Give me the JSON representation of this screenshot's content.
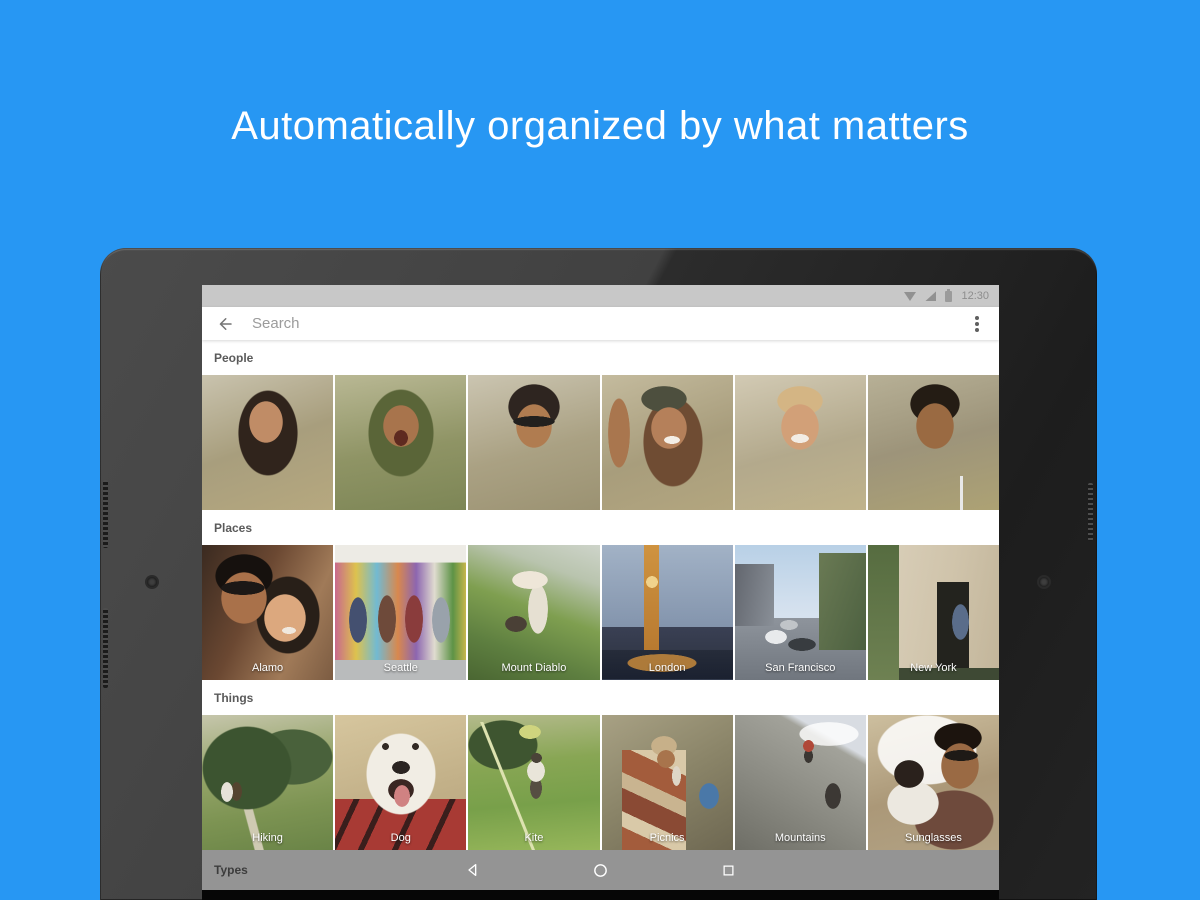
{
  "page": {
    "headline": "Automatically organized by what matters",
    "background_color": "#2797f3"
  },
  "tablet": {
    "status_bar": {
      "time": "12:30",
      "icons": [
        "wifi-icon",
        "cellular-signal-icon",
        "battery-icon"
      ]
    },
    "search_bar": {
      "back_icon": "arrow-left-icon",
      "placeholder": "Search",
      "menu_icon": "vertical-dots-icon"
    },
    "sections": [
      {
        "title": "People",
        "photos": [
          {
            "style": "background:radial-gradient(closest-side,#c08c66 0 97%,transparent) 48% 28%/34px 42px no-repeat,radial-gradient(closest-side,#30241c 0 97%,transparent) 50% 30%/60px 86px no-repeat,radial-gradient(closest-side at 50% 100%,#d9c394 0 97%,transparent) 50% 100%/110px 80px no-repeat,linear-gradient(160deg,#c9c3ae,#a89e7d 50%,#b6a87f)"
          },
          {
            "style": "background:radial-gradient(closest-side,#5e2a20 0 97%,transparent) 50% 46%/14px 16px no-repeat,radial-gradient(closest-side,#a8744c 0 97%,transparent) 50% 32%/36px 42px no-repeat,radial-gradient(closest-side,#5a6538 0 97%,transparent) 50% 30%/66px 88px no-repeat,radial-gradient(closest-side at 50% 100%,#4d5932 0 97%,transparent) 50% 100%/112px 64px no-repeat,linear-gradient(170deg,#b9b894,#8f9465 55%,#7d8656)"
          },
          {
            "style": "background:radial-gradient(closest-side,#22201e 0 97%,transparent) 50% 33%/42px 11px no-repeat,radial-gradient(closest-side,#b07c50 0 97%,transparent) 50% 32%/36px 44px no-repeat,radial-gradient(closest-side,#2e2520 0 97%,transparent) 50% 10%/52px 46px no-repeat,radial-gradient(closest-side at 50% 100%,#a84238 0 97%,transparent) 50% 100%/104px 70px no-repeat,linear-gradient(165deg,#cbc5b1,#aaa183 55%,#9b9272)"
          },
          {
            "style": "background:radial-gradient(closest-side,#f4eee6 0 97%,transparent) 54% 48%/16px 8px no-repeat,radial-gradient(closest-side,#b5805a 0 97%,transparent) 52% 34%/36px 42px no-repeat,radial-gradient(closest-side,#4d4f3e 0 97%,transparent) 46% 10%/46px 26px no-repeat,radial-gradient(closest-side,#a9764e 0 97%,transparent) 6% 35%/22px 70px no-repeat,radial-gradient(closest-side,#6f4c33 0 97%,transparent) 58% 48%/60px 90px no-repeat,radial-gradient(closest-side at 50% 100%,#aecdc9 0 97%,transparent) 50% 100%/100px 56px no-repeat,linear-gradient(160deg,#c4bb9e,#a89d7c 55%,#b3a67f)"
          },
          {
            "style": "background:radial-gradient(closest-side,#f2ece4 0 97%,transparent) 50% 47%/18px 9px no-repeat,radial-gradient(closest-side,#d2a078 0 97%,transparent) 50% 33%/38px 46px no-repeat,radial-gradient(closest-side,#d4b584 0 97%,transparent) 50% 10%/46px 30px no-repeat,radial-gradient(closest-side at 50% 100%,#3a50c0 0 97%,transparent) 50% 100%/116px 74px no-repeat,linear-gradient(165deg,#d2cab4,#b3a98c 55%,#c0b38b)"
          },
          {
            "style": "background:linear-gradient(#e8e8e8,#e8e8e8) 72% 100%/3px 34px no-repeat,radial-gradient(closest-side,#9a6a42 0 97%,transparent) 52% 32%/38px 46px no-repeat,radial-gradient(closest-side,#241c14 0 97%,transparent) 52% 9%/50px 40px no-repeat,radial-gradient(closest-side at 50% 100%,#54323a 0 97%,transparent) 50% 100%/110px 80px no-repeat,linear-gradient(165deg,#b7b096,#9d947a 50%,#ada274)"
          }
        ]
      },
      {
        "title": "Places",
        "photos": [
          {
            "label": "Alamo",
            "style": "background:radial-gradient(closest-side,#1c1816 0 97%,transparent) 22% 30%/44px 14px no-repeat,radial-gradient(closest-side,#f0e8de 0 97%,transparent) 68% 64%/14px 7px no-repeat,radial-gradient(closest-side,#a9714a 0 97%,transparent) 22% 32%/46px 52px no-repeat,radial-gradient(closest-side,#16110e 0 97%,transparent) 18% 10%/58px 44px no-repeat,radial-gradient(closest-side,#dca87e 0 97%,transparent) 70% 56%/42px 48px no-repeat,radial-gradient(closest-side,#281f18 0 97%,transparent) 80% 55%/64px 78px no-repeat,linear-gradient(115deg,#3a2a20,#6b4832 40%,#a07a58 72%,#7c5c42)"
          },
          {
            "label": "Seattle",
            "style": "background:radial-gradient(closest-side,#445070 0 97%,transparent) 12% 58%/18px 46px no-repeat,radial-gradient(closest-side,#6e4a3a 0 97%,transparent) 38% 58%/18px 48px no-repeat,radial-gradient(closest-side,#8a3c3c 0 97%,transparent) 62% 58%/18px 48px no-repeat,radial-gradient(closest-side,#99a2ab 0 97%,transparent) 86% 58%/18px 46px no-repeat,linear-gradient(#b9bbbc,#b9bbbc) 0 100%/100% 15% no-repeat,linear-gradient(#edebe5,#edebe5) 0 0/100% 13% no-repeat,linear-gradient(90deg,#c8698c,#ddc24e 16%,#72bad2 32%,#d8884e 48%,#8d66b0 62%,#e0dcd0 76%,#5d9346 90%,#c6b64c)"
          },
          {
            "label": "Mount Diablo",
            "style": "background:radial-gradient(closest-side,#eee6d8 0 97%,transparent) 46% 22%/36px 18px no-repeat,radial-gradient(closest-side,#e6e0d2 0 97%,transparent) 54% 46%/20px 50px no-repeat,radial-gradient(closest-side,#4a4036 0 97%,transparent) 34% 60%/22px 16px no-repeat,linear-gradient(200deg,#ced4ca,#b9c4ae 22%,#7f9f50 48%,#5e7f40 75%,#4a6632)"
          },
          {
            "label": "London",
            "style": "background:radial-gradient(closest-side,#f0d28c 0 97%,transparent) 37% 25%/12px 12px no-repeat,linear-gradient(#cf9340,#b87a30) 37% 0/15px 78% no-repeat,radial-gradient(closest-side,rgba(220,150,60,.75) 0 97%,transparent) 42% 93%/70px 18px no-repeat,linear-gradient(#262c3a,#1b2130) 0 100%/100% 22% no-repeat,linear-gradient(#3a4054,#323848) 0 76%/100% 20% no-repeat,linear-gradient(#a2b2c6,#8596ae 58%,#6a788f)"
          },
          {
            "label": "San Francisco",
            "style": "background:radial-gradient(closest-side,#e8eaec 0 97%,transparent) 28% 70%/22px 14px no-repeat,radial-gradient(closest-side,#383c40 0 97%,transparent) 52% 76%/28px 13px no-repeat,radial-gradient(closest-side,#c0c4c8 0 97%,transparent) 40% 60%/18px 10px no-repeat,linear-gradient(110deg,#6a7a54,#4c6040) 100% 20%/36% 72% no-repeat,linear-gradient(100deg,#62666e,#8a9098) 0 26%/30% 46% no-repeat,linear-gradient(#8e949c,#70767e) 0 100%/100% 46% no-repeat,linear-gradient(#b8d0e6,#d3e0ee 45%,#e9eff5)"
          },
          {
            "label": "New York",
            "style": "background:radial-gradient(closest-side,#5a6d8a 0 97%,transparent) 74% 60%/17px 36px no-repeat,linear-gradient(#23231e,#23231e) 70% 75%/32px 86px no-repeat,linear-gradient(#566c40,#6e8152) 0 0/24% 100% no-repeat,linear-gradient(#3e4934,#3e4934) 0 100%/100% 9% no-repeat,linear-gradient(100deg,#dbd1bc,#cfc3aa 60%,#c2b59a)"
          }
        ]
      },
      {
        "title": "Things",
        "photos": [
          {
            "label": "Hiking",
            "style": "background:radial-gradient(closest-side,#e6e2d8 0 97%,transparent) 16% 58%/12px 20px no-repeat,radial-gradient(closest-side,#54442f 0 97%,transparent) 24% 58%/11px 19px no-repeat,radial-gradient(closest-side,#3c5430 0 97%,transparent) 0% 22%/90px 84px no-repeat,radial-gradient(closest-side,#49613b 0 97%,transparent) 100% 18%/80px 56px no-repeat,linear-gradient(75deg,transparent 46%,#cfcab2 47% 54%,transparent 55%) 0 100%/70% 60% no-repeat,linear-gradient(170deg,#c6c6ac,#94a468 40%,#7c9352 70%,#6a8447)"
          },
          {
            "label": "Dog",
            "style": "background:radial-gradient(closest-side,#d08282 0 97%,transparent) 51% 62%/16px 22px no-repeat,radial-gradient(closest-side,#3a2622 0 97%,transparent) 50% 57%/26px 22px no-repeat,radial-gradient(closest-side,#2a2421 0 97%,transparent) 50% 38%/18px 13px no-repeat,radial-gradient(closest-side,#322a24 0 97%,transparent) 38% 22%/7px 7px no-repeat,radial-gradient(closest-side,#322a24 0 97%,transparent) 62% 22%/7px 7px no-repeat,radial-gradient(closest-side,#f1ede4 0 97%,transparent) 50% 34%/70px 82px no-repeat,linear-gradient(115deg,#a83a34 0 12%,#3a1e1c 12% 16%,#a83a34 16% 30%,#3a1e1c 30% 34%,#a83a34 34% 52%,#3a1e1c 52% 56%,#a83a34 56% 74%,#3a1e1c 74% 78%,#a83a34 78%) 0 100%/100% 38% no-repeat,linear-gradient(165deg,#d6c69e,#c3b189 55%,#b5a37c)"
          },
          {
            "label": "Kite",
            "style": "background:radial-gradient(closest-side,#cfd47e 0 97%,transparent) 46% 8%/22px 14px no-repeat,radial-gradient(closest-side,#4a4338 0 97%,transparent) 52% 30%/11px 10px no-repeat,radial-gradient(closest-side,#e9e5d9 0 97%,transparent) 52% 40%/18px 22px no-repeat,radial-gradient(closest-side,#564e42 0 97%,transparent) 52% 55%/12px 22px no-repeat,linear-gradient(68deg,transparent 48.5%,#dde2b0 49% 51%,transparent 51.5%) 0 100%/60% 95% no-repeat,radial-gradient(closest-side,#3e5530 0 97%,transparent) 0% 6%/70px 50px no-repeat,linear-gradient(175deg,#b4ba8c,#88a654 35%,#78a04a 65%,#96b65a)"
          },
          {
            "label": "Picnics",
            "style": "background:radial-gradient(closest-side,#ded6c6 0 97%,transparent) 58% 44%/9px 20px no-repeat,radial-gradient(closest-side,#a8744c 0 97%,transparent) 49% 30%/18px 18px no-repeat,radial-gradient(closest-side,#c7b089 0 97%,transparent) 47% 18%/26px 20px no-repeat,linear-gradient(25deg,#a35c3c 0 18%,#d9c9a8 18% 30%,#8a4a34 30% 48%,#c9b490 48% 60%,#a35c3c 60% 80%,#d9c9a8 80%) 30% 100%/64px 100px no-repeat,radial-gradient(closest-side,#4a78a8 0 97%,transparent) 88% 62%/20px 26px no-repeat,linear-gradient(150deg,#a8a184,#8a8468 50%,#6e6852)"
          },
          {
            "label": "Mountains",
            "style": "background:radial-gradient(closest-side,#b04838 0 97%,transparent) 57% 20%/11px 12px no-repeat,radial-gradient(closest-side,#3a3632 0 97%,transparent) 57% 28%/9px 14px no-repeat,radial-gradient(closest-side,#3c3834 0 97%,transparent) 78% 62%/16px 26px no-repeat,radial-gradient(closest-side,rgba(255,255,255,.8) 0 97%,transparent) 90% 6%/60px 24px no-repeat,linear-gradient(210deg,#d8dce2 0 20%,#a2a29a 24%,#8a8a82 60%,#6e6e66)"
          },
          {
            "label": "Sunglasses",
            "style": "background:radial-gradient(closest-side,#1e1a16 0 97%,transparent) 78% 28%/34px 11px no-repeat,radial-gradient(closest-side,#9a6a44 0 97%,transparent) 78% 32%/38px 46px no-repeat,radial-gradient(closest-side,#1c140e 0 97%,transparent) 80% 8%/48px 30px no-repeat,radial-gradient(closest-side,#2a211c 0 97%,transparent) 26% 42%/30px 28px no-repeat,radial-gradient(closest-side,#ece8e0 0 97%,transparent) 24% 72%/52px 44px no-repeat,radial-gradient(closest-side,#6e4a3c 0 97%,transparent) 90% 100%/80px 60px no-repeat,radial-gradient(closest-side,rgba(255,255,255,.85) 0 97%,transparent) 30% 0%/100px 70px no-repeat,linear-gradient(165deg,#cdbf9f,#ab9878 55%,#b2a284)"
          }
        ]
      },
      {
        "title": "Types",
        "photos": []
      }
    ],
    "nav": {
      "buttons": [
        "back-triangle-icon",
        "home-circle-icon",
        "recents-square-icon"
      ]
    }
  }
}
